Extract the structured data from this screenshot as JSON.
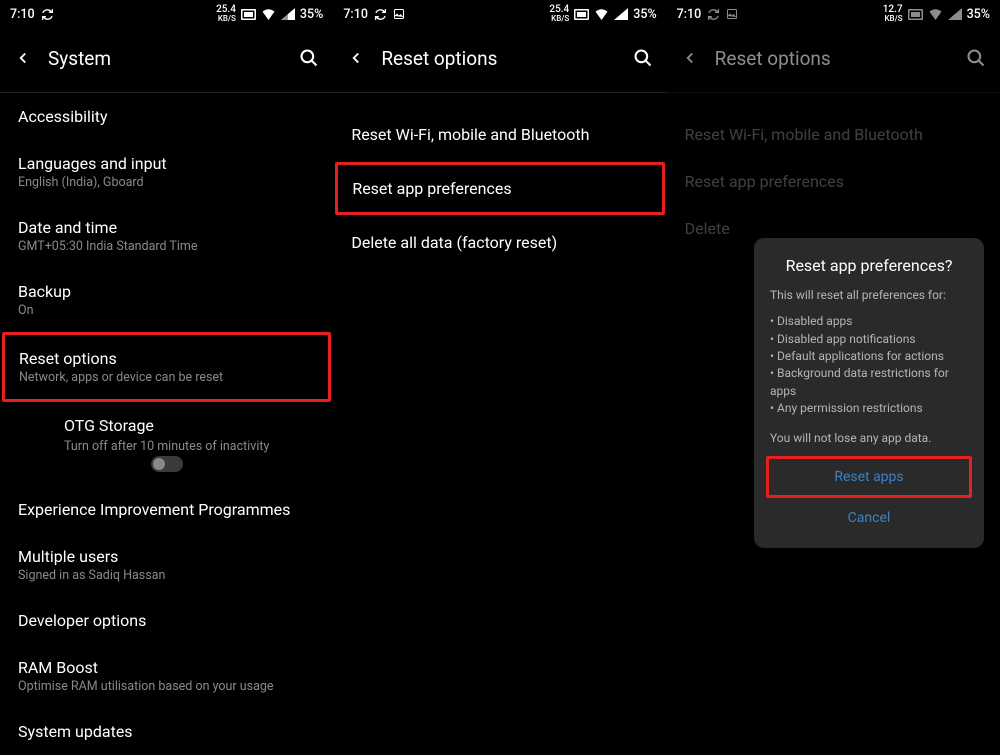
{
  "status": {
    "time": "7:10",
    "kbps": "25.4",
    "kbps_unit": "KB/S",
    "kbps_alt": "12.7",
    "battery": "35%"
  },
  "screen1": {
    "title": "System",
    "items": [
      {
        "t": "Accessibility",
        "s": ""
      },
      {
        "t": "Languages and input",
        "s": "English (India), Gboard"
      },
      {
        "t": "Date and time",
        "s": "GMT+05:30 India Standard Time"
      },
      {
        "t": "Backup",
        "s": "On"
      },
      {
        "t": "Reset options",
        "s": "Network, apps or device can be reset"
      },
      {
        "t": "OTG Storage",
        "s": "Turn off after 10 minutes of inactivity"
      },
      {
        "t": "Experience Improvement Programmes",
        "s": ""
      },
      {
        "t": "Multiple users",
        "s": "Signed in as Sadiq Hassan"
      },
      {
        "t": "Developer options",
        "s": ""
      },
      {
        "t": "RAM Boost",
        "s": "Optimise RAM utilisation based on your usage"
      },
      {
        "t": "System updates",
        "s": ""
      }
    ]
  },
  "screen2": {
    "title": "Reset options",
    "items": [
      {
        "t": "Reset Wi-Fi, mobile and Bluetooth"
      },
      {
        "t": "Reset app preferences"
      },
      {
        "t": "Delete all data (factory reset)"
      }
    ]
  },
  "screen3": {
    "title": "Reset options",
    "items": [
      {
        "t": "Reset Wi-Fi, mobile and Bluetooth"
      },
      {
        "t": "Reset app preferences"
      },
      {
        "t": "Delete"
      }
    ],
    "dialog": {
      "title": "Reset app preferences?",
      "intro": "This will reset all preferences for:",
      "bullets": [
        "Disabled apps",
        "Disabled app notifications",
        "Default applications for actions",
        "Background data restrictions for apps",
        "Any permission restrictions"
      ],
      "note": "You will not lose any app data.",
      "primary": "Reset apps",
      "secondary": "Cancel"
    }
  }
}
